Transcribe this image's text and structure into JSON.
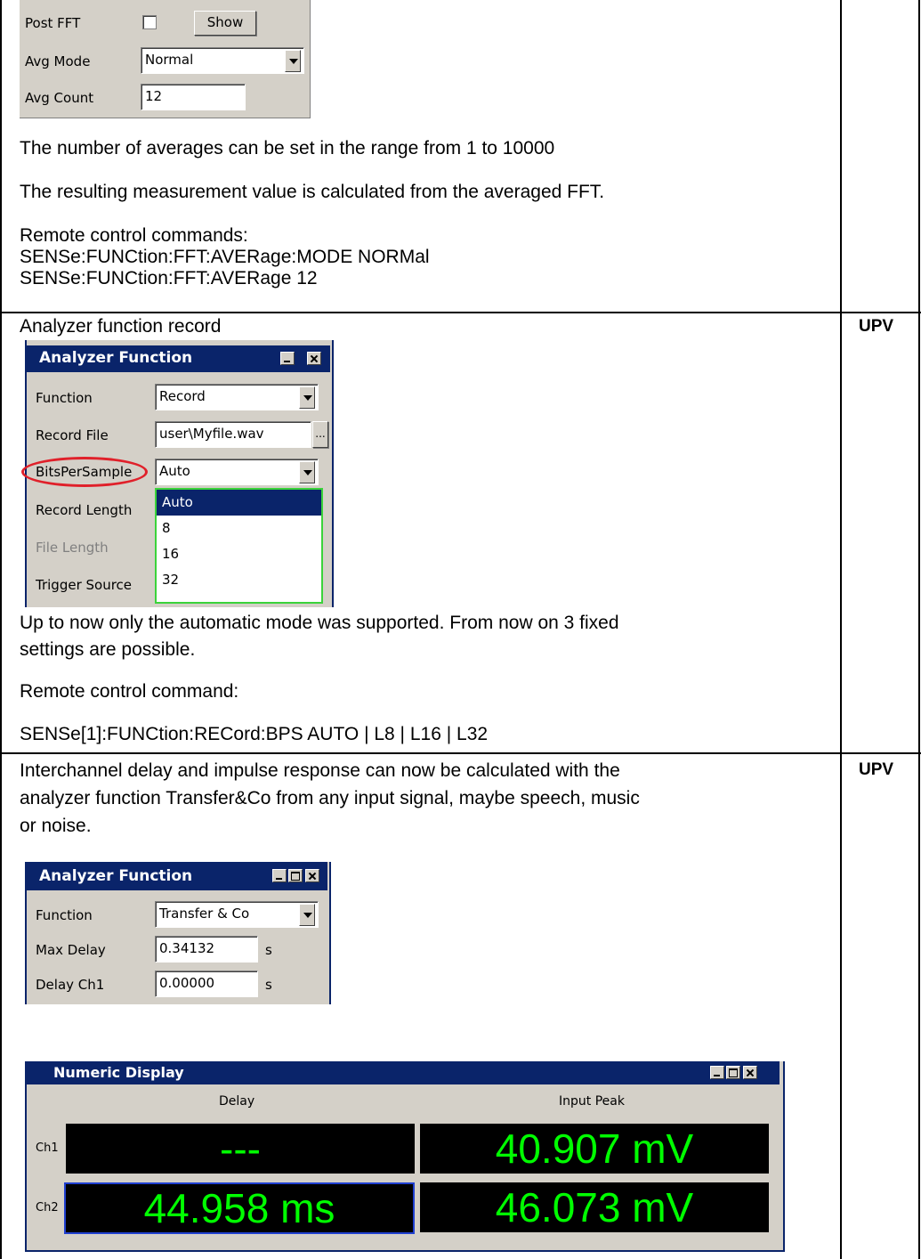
{
  "section1": {
    "panel": {
      "post_fft_label": "Post FFT",
      "show_button": "Show",
      "avg_mode_label": "Avg Mode",
      "avg_mode_value": "Normal",
      "avg_count_label": "Avg Count",
      "avg_count_value": "12"
    },
    "para1": "The number of averages can be set in the range from 1 to 10000",
    "para2": "The resulting measurement value is calculated from the averaged FFT.",
    "remote_heading": "Remote control commands:",
    "cmd1": "SENSe:FUNCtion:FFT:AVERage:MODE NORMal",
    "cmd2": "SENSe:FUNCtion:FFT:AVERage 12"
  },
  "section2": {
    "heading": "Analyzer function record",
    "tag": "UPV",
    "window_title": "Analyzer Function",
    "rows": {
      "function_label": "Function",
      "function_value": "Record",
      "record_file_label": "Record File",
      "record_file_value": "user\\Myfile.wav",
      "browse_label": "...",
      "bps_label": "BitsPerSample",
      "bps_value": "Auto",
      "record_length_label": "Record Length",
      "file_length_label": "File Length",
      "trigger_source_label": "Trigger Source"
    },
    "bps_options": [
      "Auto",
      "8",
      "16",
      "32"
    ],
    "para_line1": "Up to now only the automatic mode was supported. From now on 3 fixed",
    "para_line2": "settings are possible.",
    "remote_heading": "Remote control command:",
    "cmd": "SENSe[1]:FUNCtion:RECord:BPS AUTO | L8 | L16 | L32"
  },
  "section3": {
    "tag": "UPV",
    "para_line1": "Interchannel delay and impulse response can now be calculated with the",
    "para_line2": "analyzer function Transfer&Co from any input signal, maybe speech, music",
    "para_line3": "or noise.",
    "window_title": "Analyzer Function",
    "function_label": "Function",
    "function_value": "Transfer & Co",
    "max_delay_label": "Max Delay",
    "max_delay_value": "0.34132",
    "max_delay_unit": "s",
    "delay_ch1_label": "Delay Ch1",
    "delay_ch1_value": "0.00000",
    "delay_ch1_unit": "s",
    "numeric_display": {
      "title": "Numeric Display",
      "col_delay": "Delay",
      "col_input_peak": "Input Peak",
      "ch1_label": "Ch1",
      "ch2_label": "Ch2",
      "ch1_delay": "---",
      "ch1_peak": "40.907 mV",
      "ch2_delay": "44.958 ms",
      "ch2_peak": "46.073 mV"
    }
  },
  "colors": {
    "title_bar": "#0a246a",
    "dialog_bg": "#d4d0c8",
    "readout_green": "#00ff00",
    "highlight_ring": "#e0202a"
  }
}
